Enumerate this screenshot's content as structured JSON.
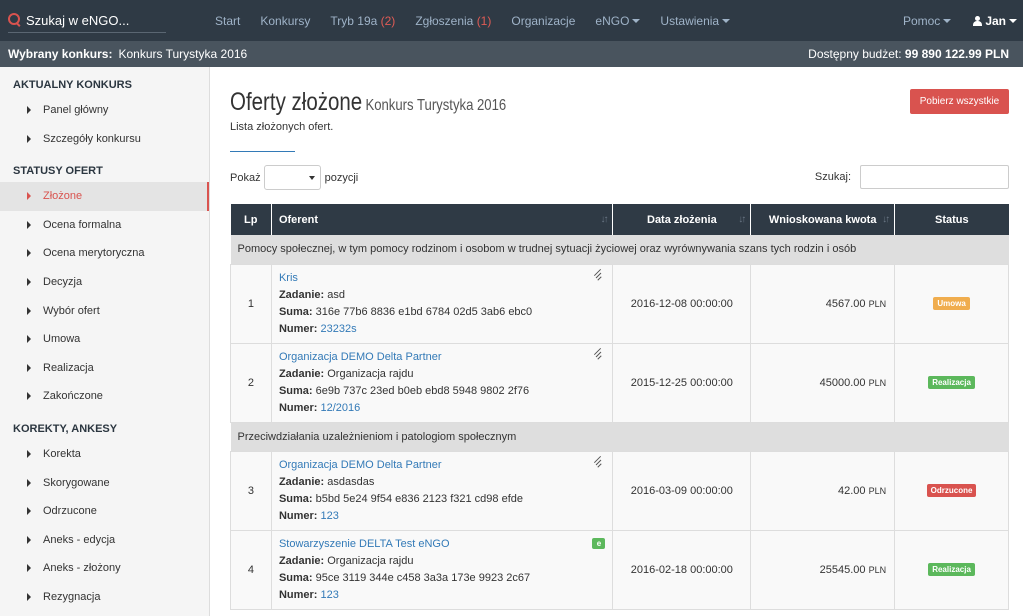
{
  "search": {
    "placeholder": "Szukaj w eNGO..."
  },
  "nav": [
    {
      "label": "Start"
    },
    {
      "label": "Konkursy"
    },
    {
      "label": "Tryb 19a",
      "count": "(2)"
    },
    {
      "label": "Zgłoszenia",
      "count": "(1)"
    },
    {
      "label": "Organizacje"
    },
    {
      "label": "eNGO",
      "dropdown": true
    },
    {
      "label": "Ustawienia",
      "dropdown": true
    }
  ],
  "right_nav": {
    "help": "Pomoc",
    "user": "Jan"
  },
  "subbar": {
    "selected_label": "Wybrany konkurs:",
    "selected_value": "Konkurs Turystyka 2016",
    "budget_label": "Dostępny budżet:",
    "budget_value": "99 890 122.99 PLN"
  },
  "sidebar": {
    "sections": [
      {
        "title": "AKTUALNY KONKURS",
        "items": [
          "Panel główny",
          "Szczegóły konkursu"
        ]
      },
      {
        "title": "STATUSY OFERT",
        "items": [
          "Złożone",
          "Ocena formalna",
          "Ocena merytoryczna",
          "Decyzja",
          "Wybór ofert",
          "Umowa",
          "Realizacja",
          "Zakończone"
        ]
      },
      {
        "title": "KOREKTY, ANKESY",
        "items": [
          "Korekta",
          "Skorygowane",
          "Odrzucone",
          "Aneks - edycja",
          "Aneks - złożony",
          "Rezygnacja"
        ]
      }
    ],
    "active": "Złożone"
  },
  "page": {
    "title": "Oferty złożone",
    "title_small": "Konkurs Turystyka 2016",
    "subtitle": "Lista złożonych ofert.",
    "download_button": "Pobierz wszystkie"
  },
  "controls": {
    "show_label": "Pokaż",
    "show_suffix": "pozycji",
    "search_label": "Szukaj:"
  },
  "table": {
    "headers": [
      "Lp",
      "Oferent",
      "Data złożenia",
      "Wnioskowana kwota",
      "Status"
    ],
    "field_labels": {
      "task": "Zadanie:",
      "sum": "Suma:",
      "number": "Numer:"
    },
    "groups": [
      {
        "name": "Pomocy społecznej, w tym pomocy rodzinom i osobom w trudnej sytuacji życiowej oraz wyrównywania szans tych rodzin i osób",
        "rows": [
          {
            "lp": "1",
            "org": "Kris",
            "task": "asd",
            "sum": "316e 77b6 8836 e1bd 6784 02d5 3ab6 ebc0",
            "number": "23232s",
            "date": "2016-12-08 00:00:00",
            "amount": "4567.00",
            "currency": "PLN",
            "status": "Umowa",
            "status_color": "#f0ad4e",
            "icon": "signature-icon"
          },
          {
            "lp": "2",
            "org": "Organizacja DEMO Delta Partner",
            "task": "Organizacja rajdu",
            "sum": "6e9b 737c 23ed b0eb ebd8 5948 9802 2f76",
            "number": "12/2016",
            "date": "2015-12-25 00:00:00",
            "amount": "45000.00",
            "currency": "PLN",
            "status": "Realizacja",
            "status_color": "#5cb85c",
            "icon": "signature-icon"
          }
        ]
      },
      {
        "name": "Przeciwdziałania uzależnieniom i patologiom społecznym",
        "rows": [
          {
            "lp": "3",
            "org": "Organizacja DEMO Delta Partner",
            "task": "asdasdas",
            "sum": "b5bd 5e24 9f54 e836 2123 f321 cd98 efde",
            "number": "123",
            "date": "2016-03-09 00:00:00",
            "amount": "42.00",
            "currency": "PLN",
            "status": "Odrzucone",
            "status_color": "#d9534f",
            "icon": "signature-icon"
          },
          {
            "lp": "4",
            "org": "Stowarzyszenie DELTA Test eNGO",
            "task": "Organizacja rajdu",
            "sum": "95ce 3119 344e c458 3a3a 173e 9923 2c67",
            "number": "123",
            "date": "2016-02-18 00:00:00",
            "amount": "25545.00",
            "currency": "PLN",
            "status": "Realizacja",
            "status_color": "#5cb85c",
            "icon": "e-badge-icon",
            "badge": "e"
          }
        ]
      }
    ]
  }
}
